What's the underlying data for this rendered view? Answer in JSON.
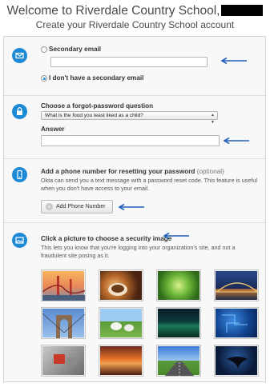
{
  "header": {
    "title": "Welcome to Riverdale Country School,",
    "subtitle": "Create your Riverdale Country School account"
  },
  "email_section": {
    "icon": "envelope-icon",
    "secondary_label": "Secondary email",
    "secondary_value": "",
    "no_secondary_label": "I don't have a secondary email",
    "selected_option": "I don't have a secondary email"
  },
  "password_section": {
    "icon": "lock-icon",
    "question_label": "Choose a forgot-password question",
    "question_selected": "What is the food you least liked as a child?",
    "answer_label": "Answer",
    "answer_value": ""
  },
  "phone_section": {
    "icon": "mobile-phone-icon",
    "title": "Add a phone number for resetting your password",
    "optional": "(optional)",
    "description_line1": "Okta can send you a text message with a password reset code. This feature is useful",
    "description_line2": "when you don't have access to your email.",
    "button_label": "Add Phone Number"
  },
  "image_section": {
    "icon": "picture-icon",
    "title": "Click a picture to choose a security image",
    "description_line1": "This lets you know that you're logging into your organization's site, and not a",
    "description_line2": "fraudulent site posing as it.",
    "images": [
      "golden-gate-bridge",
      "coffee-cup",
      "green-succulent",
      "harbour-bridge-night",
      "brooklyn-bridge",
      "goats-in-field",
      "northern-lights",
      "blue-circuit",
      "red-keyboard",
      "sunset-clouds",
      "road-to-horizon",
      "manta-ray"
    ]
  },
  "colors": {
    "accent": "#1d8ad6",
    "arrow": "#1f5fb8"
  }
}
